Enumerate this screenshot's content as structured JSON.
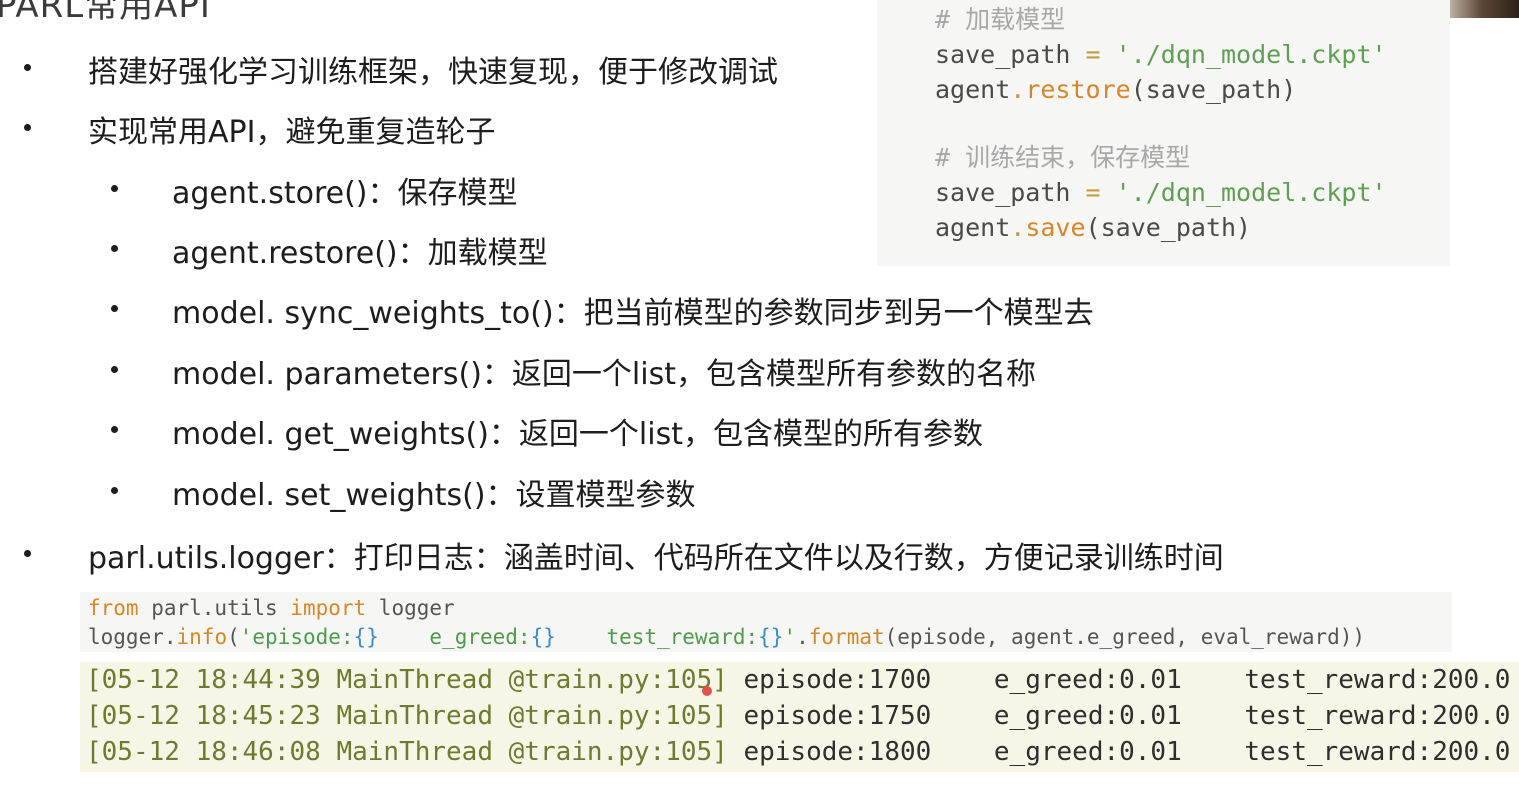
{
  "slide": {
    "title_partial": "PARL常用API"
  },
  "code_top": {
    "comment_load": "# 加载模型",
    "line1_var": "save_path",
    "line1_op": " = ",
    "line1_str": "'./dqn_model.ckpt'",
    "line2_obj": "agent",
    "line2_dot": ".",
    "line2_fn": "restore",
    "line2_args": "(save_path)",
    "comment_save": "# 训练结束，保存模型",
    "line3_var": "save_path",
    "line3_op": " = ",
    "line3_str": "'./dqn_model.ckpt'",
    "line4_obj": "agent",
    "line4_dot": ".",
    "line4_fn": "save",
    "line4_args": "(save_path)"
  },
  "bullets": [
    "搭建好强化学习训练框架，快速复现，便于修改调试",
    "实现常用API，避免重复造轮子",
    "agent.store()：保存模型",
    "agent.restore()：加载模型",
    "model. sync_weights_to()：把当前模型的参数同步到另一个模型去",
    "model. parameters()：返回一个list，包含模型所有参数的名称",
    "model. get_weights()：返回一个list，包含模型的所有参数",
    "model. set_weights()：设置模型参数",
    "parl.utils.logger：打印日志：涵盖时间、代码所在文件以及行数，方便记录训练时间"
  ],
  "code_mid": {
    "l1_from": "from",
    "l1_mod": " parl.utils ",
    "l1_import": "import",
    "l1_name": " logger",
    "l2_obj": "logger.",
    "l2_fn": "info",
    "l2_open": "(",
    "l2_str1": "'episode:",
    "l2_b1": "{}",
    "l2_str2": "    e_greed:",
    "l2_b2": "{}",
    "l2_str3": "    test_reward:",
    "l2_b3": "{}",
    "l2_str4": "'",
    "l2_dot": ".",
    "l2_fmt": "format",
    "l2_args": "(episode, agent.e_greed, eval_reward))"
  },
  "log": [
    {
      "head": "[05-12 18:44:39 MainThread @train.py:105]",
      "body": " episode:1700    e_greed:0.01    test_reward:200.0"
    },
    {
      "head": "[05-12 18:45:23 MainThread @train.py:105]",
      "body": " episode:1750    e_greed:0.01    test_reward:200.0"
    },
    {
      "head": "[05-12 18:46:08 MainThread @train.py:105]",
      "body": " episode:1800    e_greed:0.01    test_reward:200.0"
    }
  ]
}
